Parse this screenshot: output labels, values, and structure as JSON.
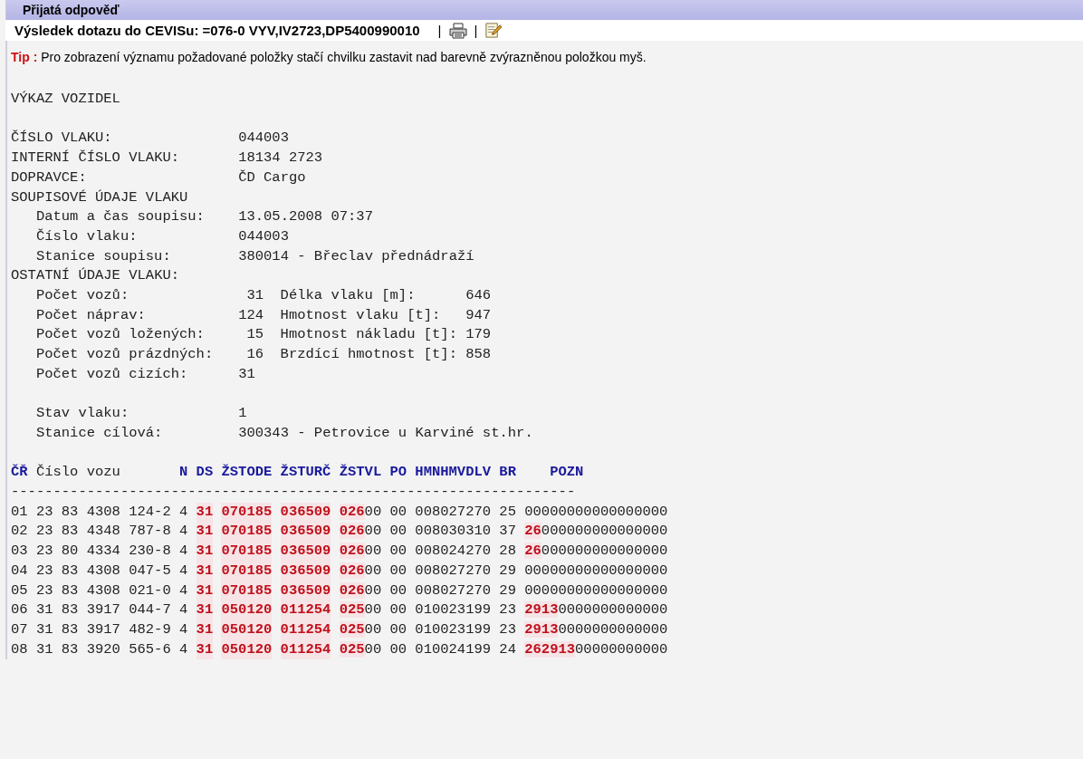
{
  "panel": {
    "title": "Přijatá odpověď"
  },
  "query": {
    "text": "Výsledek dotazu do CEVISu: =076-0 VYV,IV2723,DP5400990010",
    "separators": [
      "|",
      "|"
    ]
  },
  "tip": {
    "label": "Tip :",
    "text": "Pro zobrazení významu požadované položky stačí chvilku zastavit nad barevně zvýrazněnou položkou myš."
  },
  "report_title": "VÝKAZ VOZIDEL",
  "info": [
    {
      "label": "ČÍSLO VLAKU:",
      "value": "044003"
    },
    {
      "label": "INTERNÍ ČÍSLO VLAKU:",
      "value": "18134 2723"
    },
    {
      "label": "DOPRAVCE:",
      "value": "ČD Cargo"
    },
    {
      "label": "SOUPISOVÉ ÚDAJE VLAKU",
      "children": [
        {
          "label": "Datum a čas soupisu:",
          "value": "13.05.2008 07:37"
        },
        {
          "label": "Číslo vlaku:",
          "value": "044003"
        },
        {
          "label": "Stanice soupisu:",
          "value": "380014 - Břeclav přednádraží"
        }
      ]
    },
    {
      "label": "OSTATNÍ ÚDAJE VLAKU:",
      "children": [
        {
          "label": "Počet vozů:",
          "value": "31",
          "label2": "Délka vlaku [m]:",
          "value2": "646"
        },
        {
          "label": "Počet náprav:",
          "value": "124",
          "label2": "Hmotnost vlaku [t]:",
          "value2": "947"
        },
        {
          "label": "Počet vozů ložených:",
          "value": "15",
          "label2": "Hmotnost nákladu [t]:",
          "value2": "179"
        },
        {
          "label": "Počet vozů prázdných:",
          "value": "16",
          "label2": "Brzdící hmotnost [t]:",
          "value2": "858"
        },
        {
          "label": "Počet vozů cizích:",
          "value": "31"
        },
        {
          "label": "Stav vlaku:",
          "value": "1",
          "gap_before": true
        },
        {
          "label": "Stanice cílová:",
          "value": "300343 - Petrovice u Karviné st.hr."
        }
      ]
    }
  ],
  "table": {
    "columns": [
      {
        "label": "ČŘ",
        "label_highlighted": true,
        "values_highlighted": false
      },
      {
        "label": "Číslo vozu",
        "label_highlighted": false,
        "values_highlighted": false
      },
      {
        "label": "N",
        "label_highlighted": true,
        "values_highlighted": false
      },
      {
        "label": "DS",
        "label_highlighted": true,
        "values_highlighted": true
      },
      {
        "label": "ŽSTODE",
        "label_highlighted": true,
        "values_highlighted": true
      },
      {
        "label": "ŽSTURČ",
        "label_highlighted": true,
        "values_highlighted": true
      },
      {
        "label": "ŽSTVL",
        "label_highlighted": true,
        "values_highlighted": false
      },
      {
        "label": "PO",
        "label_highlighted": true,
        "values_highlighted": false
      },
      {
        "label": "HMNHMVDLV",
        "label_highlighted": true,
        "values_highlighted": false
      },
      {
        "label": "BR",
        "label_highlighted": true,
        "values_highlighted": false
      },
      {
        "label": "POZN",
        "label_highlighted": true,
        "values_highlighted": false
      }
    ],
    "separator": "-------------------------------------------------------------------",
    "rows": [
      [
        "01",
        "23 83 4308 124-2",
        "4",
        "31",
        "070185",
        "036509",
        "**026**00",
        "00",
        "008027270",
        "25",
        "00000000000000000"
      ],
      [
        "02",
        "23 83 4348 787-8",
        "4",
        "31",
        "070185",
        "036509",
        "**026**00",
        "00",
        "008030310",
        "37",
        "**26**000000000000000"
      ],
      [
        "03",
        "23 80 4334 230-8",
        "4",
        "31",
        "070185",
        "036509",
        "**026**00",
        "00",
        "008024270",
        "28",
        "**26**000000000000000"
      ],
      [
        "04",
        "23 83 4308 047-5",
        "4",
        "31",
        "070185",
        "036509",
        "**026**00",
        "00",
        "008027270",
        "29",
        "00000000000000000"
      ],
      [
        "05",
        "23 83 4308 021-0",
        "4",
        "31",
        "070185",
        "036509",
        "**026**00",
        "00",
        "008027270",
        "29",
        "00000000000000000"
      ],
      [
        "06",
        "31 83 3917 044-7",
        "4",
        "31",
        "050120",
        "011254",
        "**025**00",
        "00",
        "010023199",
        "23",
        "**2913**0000000000000"
      ],
      [
        "07",
        "31 83 3917 482-9",
        "4",
        "31",
        "050120",
        "011254",
        "**025**00",
        "00",
        "010023199",
        "23",
        "**2913**0000000000000"
      ],
      [
        "08",
        "31 83 3920 565-6",
        "4",
        "31",
        "050120",
        "011254",
        "**025**00",
        "00",
        "010024199",
        "24",
        "**262913**00000000000"
      ]
    ]
  }
}
